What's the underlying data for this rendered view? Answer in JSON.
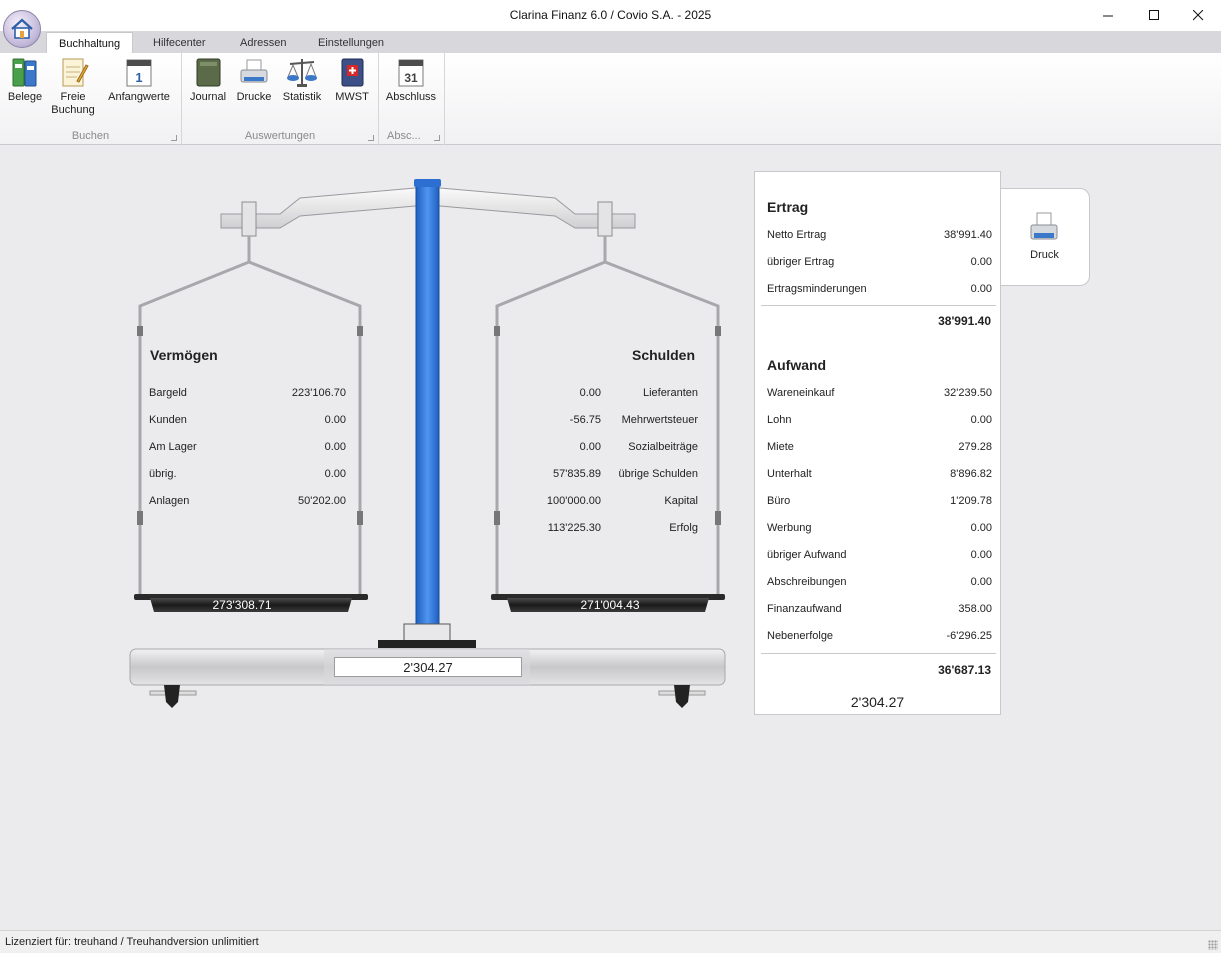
{
  "window": {
    "title": "Clarina Finanz 6.0 / Covio S.A. - 2025",
    "minimize": "—",
    "maximize": "☐",
    "close": "✕"
  },
  "tabs": [
    {
      "label": "Buchhaltung",
      "active": true
    },
    {
      "label": "Hilfecenter"
    },
    {
      "label": "Adressen"
    },
    {
      "label": "Einstellungen"
    }
  ],
  "ribbon": {
    "groups": [
      {
        "label": "Buchen",
        "buttons": [
          "Belege",
          "Freie Buchung",
          "Anfangwerte"
        ]
      },
      {
        "label": "Auswertungen",
        "buttons": [
          "Journal",
          "Drucke",
          "Statistik",
          "MWST"
        ]
      },
      {
        "label": "Absc...",
        "buttons": [
          "Abschluss"
        ]
      }
    ],
    "calendar_day": "1",
    "abschluss_day": "31",
    "freie_line1": "Freie",
    "freie_line2": "Buchung"
  },
  "vermoegen": {
    "title": "Vermögen",
    "rows": [
      {
        "label": "Bargeld",
        "value": "223'106.70"
      },
      {
        "label": "Kunden",
        "value": "0.00"
      },
      {
        "label": "Am Lager",
        "value": "0.00"
      },
      {
        "label": "übrig.",
        "value": "0.00"
      },
      {
        "label": "Anlagen",
        "value": "50'202.00"
      }
    ],
    "total": "273'308.71"
  },
  "schulden": {
    "title": "Schulden",
    "rows": [
      {
        "label": "Lieferanten",
        "value": "0.00"
      },
      {
        "label": "Mehrwertsteuer",
        "value": "-56.75"
      },
      {
        "label": "Sozialbeiträge",
        "value": "0.00"
      },
      {
        "label": "übrige Schulden",
        "value": "57'835.89"
      },
      {
        "label": "Kapital",
        "value": "100'000.00"
      },
      {
        "label": "Erfolg",
        "value": "113'225.30"
      }
    ],
    "total": "271'004.43"
  },
  "balance_difference": "2'304.27",
  "ertrag": {
    "title": "Ertrag",
    "rows": [
      {
        "label": "Netto Ertrag",
        "value": "38'991.40"
      },
      {
        "label": "übriger Ertrag",
        "value": "0.00"
      },
      {
        "label": "Ertragsminderungen",
        "value": "0.00"
      }
    ],
    "total": "38'991.40"
  },
  "aufwand": {
    "title": "Aufwand",
    "rows": [
      {
        "label": "Wareneinkauf",
        "value": "32'239.50"
      },
      {
        "label": "Lohn",
        "value": "0.00"
      },
      {
        "label": "Miete",
        "value": "279.28"
      },
      {
        "label": "Unterhalt",
        "value": "8'896.82"
      },
      {
        "label": "Büro",
        "value": "1'209.78"
      },
      {
        "label": "Werbung",
        "value": "0.00"
      },
      {
        "label": "übriger Aufwand",
        "value": "0.00"
      },
      {
        "label": "Abschreibungen",
        "value": "0.00"
      },
      {
        "label": "Finanzaufwand",
        "value": "358.00"
      },
      {
        "label": "Nebenerfolge",
        "value": "-6'296.25"
      }
    ],
    "total": "36'687.13"
  },
  "erfolg_result": "2'304.27",
  "druck_label": "Druck",
  "status": "Lizenziert für: treuhand / Treuhandversion unlimitiert"
}
